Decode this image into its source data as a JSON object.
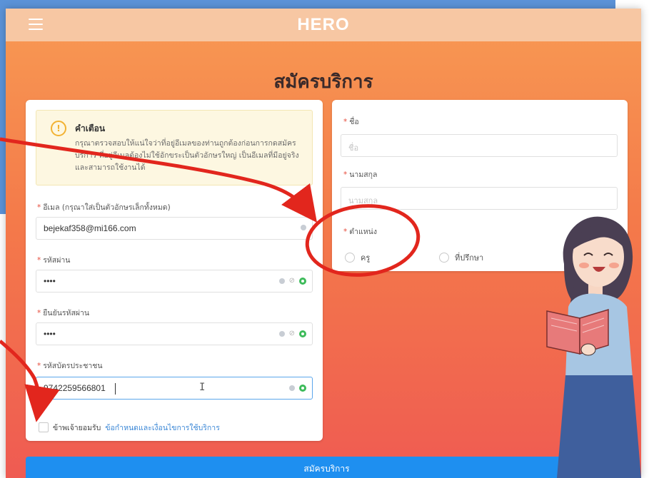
{
  "app": {
    "brand": "HERO",
    "page_title": "สมัครบริการ"
  },
  "warning": {
    "title": "คำเตือน",
    "body": "กรุณาตรวจสอบให้แน่ใจว่าที่อยู่อีเมลของท่านถูกต้องก่อนการกดสมัครบริการ ที่อยู่อีเมลต้องไม่ใช้อักขระเป็นตัวอักษรใหญ่ เป็นอีเมลที่มีอยู่จริงและสามารถใช้งานได้"
  },
  "form_left": {
    "email_label": "อีเมล (กรุณาใส่เป็นตัวอักษรเล็กทั้งหมด)",
    "email_value": "bejekaf358@mi166.com",
    "password_label": "รหัสผ่าน",
    "password_value": "••••",
    "confirm_label": "ยืนยันรหัสผ่าน",
    "confirm_value": "••••",
    "citizen_label": "รหัสบัตรประชาชน",
    "citizen_value": "9742259566801",
    "agree_text": "ข้าพเจ้ายอมรับ",
    "agree_link": "ข้อกำหนดและเงื่อนไขการใช้บริการ"
  },
  "form_right": {
    "first_name_label": "ชื่อ",
    "first_name_placeholder": "ชื่อ",
    "last_name_label": "นามสกุล",
    "last_name_placeholder": "นามสกุล",
    "position_label": "ตำแหน่ง",
    "position_options": [
      "ครู",
      "ที่ปรึกษา"
    ]
  },
  "submit_label": "สมัครบริการ",
  "colors": {
    "annotation": "#e2261d",
    "submit": "#1e8ff0",
    "topbar": "#f7c7a3"
  }
}
